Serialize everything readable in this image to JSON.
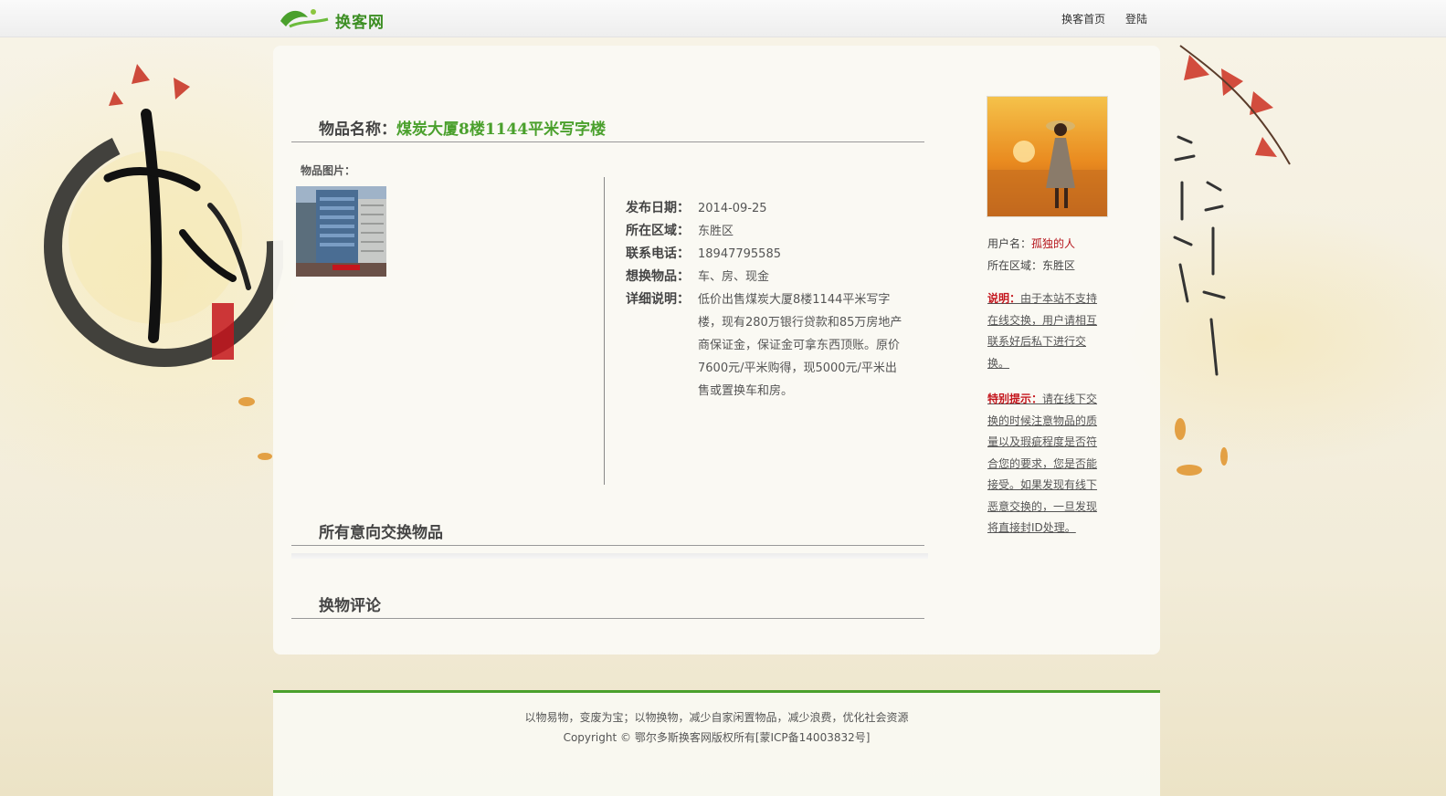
{
  "header": {
    "logo_text": "换客网",
    "links": [
      "换客首页",
      "登陆"
    ]
  },
  "item": {
    "name_label": "物品名称：",
    "name": "煤炭大厦8楼1144平米写字楼",
    "pic_label": "物品图片：",
    "details": [
      {
        "key": "发布日期：",
        "value": "2014-09-25"
      },
      {
        "key": "所在区域：",
        "value": "东胜区"
      },
      {
        "key": "联系电话：",
        "value": "18947795585"
      },
      {
        "key": "想换物品：",
        "value": "车、房、现金"
      },
      {
        "key": "详细说明：",
        "value": "低价出售煤炭大厦8楼1144平米写字楼，现有280万银行贷款和85万房地产商保证金，保证金可拿东西顶账。原价7600元/平米购得，现5000元/平米出售或置换车和房。"
      }
    ]
  },
  "sections": {
    "all_title": "所有意向交换物品",
    "comment_title": "换物评论"
  },
  "user": {
    "name_label": "用户名：",
    "name": "孤独的人",
    "region_label": "所在区域：",
    "region": "东胜区"
  },
  "notices": {
    "n1_head": "说明：",
    "n1_body": "由于本站不支持在线交换，用户请相互联系好后私下进行交换。",
    "n2_head": "特别提示：",
    "n2_body": "请在线下交换的时候注意物品的质量以及瑕疵程度是否符合您的要求，您是否能接受。如果发现有线下恶意交换的，一旦发现将直接封ID处理。"
  },
  "footer": {
    "line1": "以物易物，变废为宝；以物换物，减少自家闲置物品，减少浪费，优化社会资源",
    "line2": "Copyright © 鄂尔多斯换客网版权所有[蒙ICP备14003832号]"
  },
  "colors": {
    "accent": "#4aa02c",
    "warning": "#c4151c"
  }
}
